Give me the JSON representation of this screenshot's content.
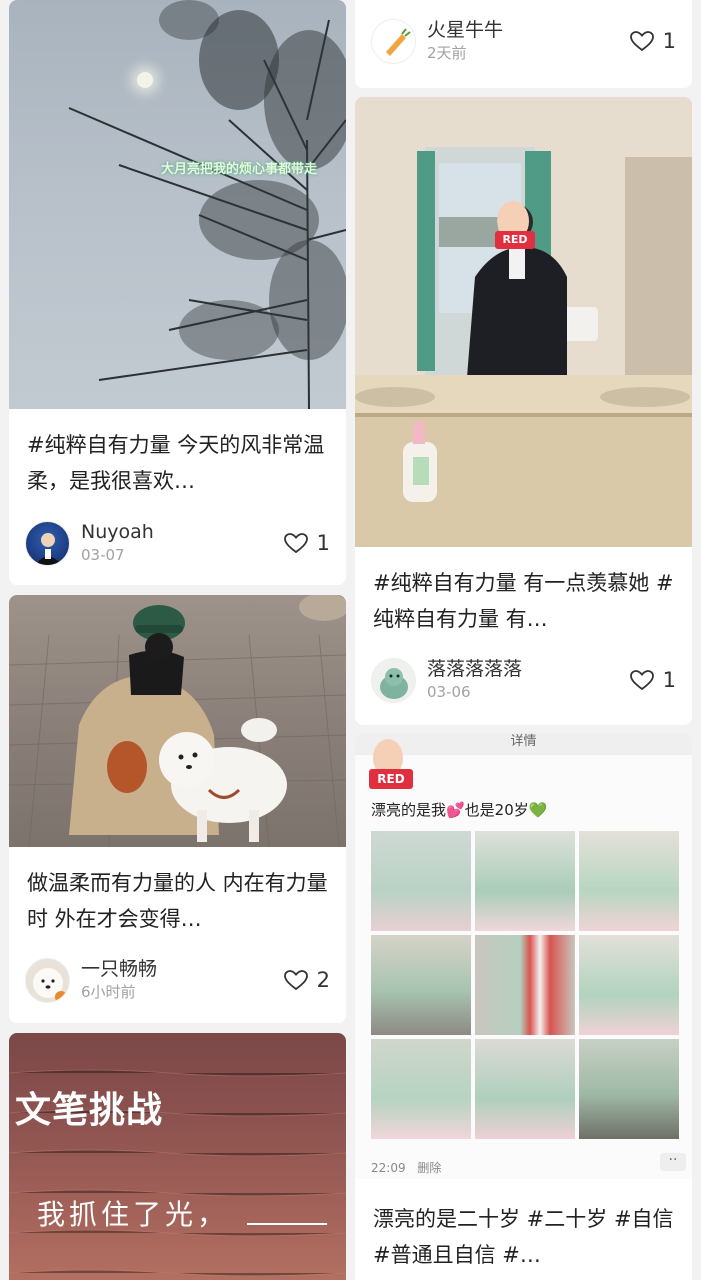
{
  "left": {
    "card1": {
      "overlay": "大月亮把我的烦心事都带走",
      "title": "#纯粹自有力量 今天的风非常温柔，是我很喜欢…",
      "author": "Nuyoah",
      "time": "03-07",
      "likes": "1"
    },
    "card2": {
      "title": "做温柔而有力量的人 内在有力量时 外在才会变得…",
      "author": "一只畅畅",
      "time": "6小时前",
      "likes": "2"
    },
    "card3": {
      "heading": "文笔挑战",
      "line": "我抓住了光，"
    }
  },
  "right": {
    "card0": {
      "author": "火星牛牛",
      "time": "2天前",
      "likes": "1"
    },
    "card1": {
      "badge": "RED",
      "title": "#纯粹自有力量 有一点羡慕她 #纯粹自有力量 有…",
      "author": "落落落落落",
      "time": "03-06",
      "likes": "1"
    },
    "card2": {
      "top_label": "详情",
      "badge": "RED",
      "caption": "漂亮的是我💕也是20岁💚",
      "footer_time": "22:09",
      "footer_delete": "删除",
      "title": "漂亮的是二十岁 #二十岁 #自信 #普通且自信 #…"
    }
  },
  "colors": {
    "heart": "#333333",
    "red_badge": "#e03040",
    "muted": "#a2a2a2"
  },
  "icons": {
    "like": "heart-outline-icon",
    "more": "more-dots-icon"
  }
}
